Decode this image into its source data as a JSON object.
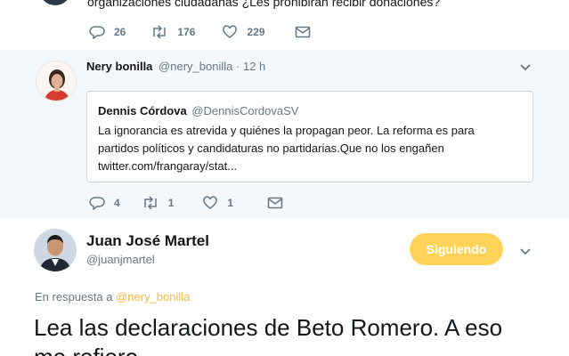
{
  "top_tweet": {
    "text": "organizaciones ciudadanas ¿Les prohibirán recibir donaciones?",
    "actions": {
      "replies": "26",
      "retweets": "176",
      "likes": "229"
    },
    "icons": [
      "reply-icon",
      "retweet-icon",
      "heart-icon",
      "message-icon"
    ]
  },
  "reply_tweet": {
    "name": "Nery bonilla",
    "handle": "@nery_bonilla",
    "separator": "·",
    "time": "12 h",
    "quote": {
      "name": "Dennis Córdova",
      "handle": "@DennisCordovaSV",
      "lines": [
        "La ignorancia es atrevida y quiénes la propagan peor. La reforma es para",
        "partidos políticos y candidaturas no partidarias.Que no los engañen",
        "twitter.com/frangaray/stat..."
      ]
    },
    "actions": {
      "replies": "4",
      "retweets": "1",
      "likes": "1"
    }
  },
  "main_tweet": {
    "name": "Juan José Martel",
    "handle": "@juanjmartel",
    "follow_label": "Siguiendo",
    "reply_to_prefix": "En respuesta a",
    "reply_to_handle": "@nery_bonilla",
    "text_line1": "Lea las declaraciones de Beto Romero. A eso",
    "text_line2": "me refiero."
  },
  "colors": {
    "accent": "#ffd35a",
    "muted": "#657786",
    "reply_bg": "#f5f8fa",
    "link": "#f6b73c"
  }
}
